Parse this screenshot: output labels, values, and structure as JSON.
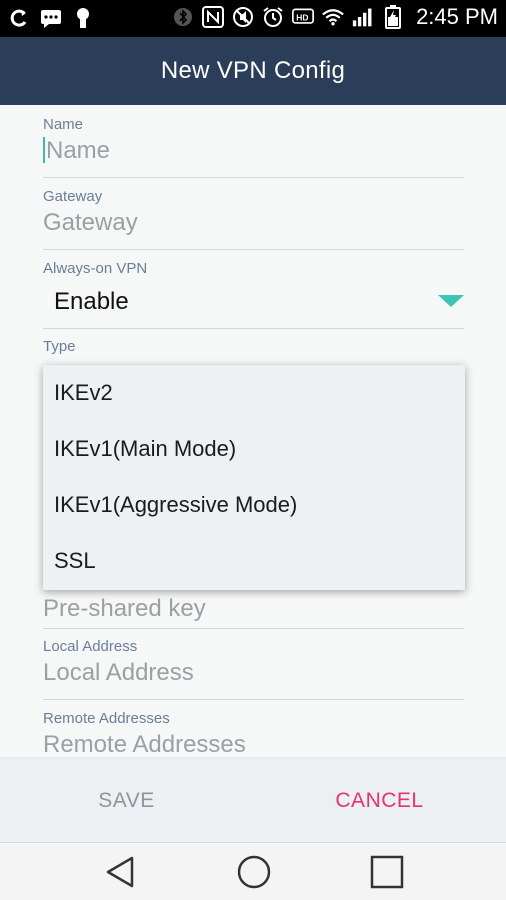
{
  "status_bar": {
    "time": "2:45 PM",
    "battery": "charging",
    "signal": "full",
    "wifi": "connected"
  },
  "app_bar": {
    "title": "New VPN Config"
  },
  "form": {
    "name": {
      "label": "Name",
      "placeholder": "Name"
    },
    "gateway": {
      "label": "Gateway",
      "placeholder": "Gateway"
    },
    "always_on": {
      "label": "Always-on VPN",
      "value": "Enable"
    },
    "type": {
      "label": "Type"
    },
    "psk": {
      "placeholder": "Pre-shared key"
    },
    "local_address": {
      "label": "Local Address",
      "placeholder": "Local Address"
    },
    "remote_addresses": {
      "label": "Remote Addresses",
      "placeholder": "Remote Addresses"
    }
  },
  "type_menu": {
    "options": [
      "IKEv2",
      "IKEv1(Main Mode)",
      "IKEv1(Aggressive Mode)",
      "SSL"
    ]
  },
  "actions": {
    "save": "SAVE",
    "cancel": "CANCEL"
  },
  "nav": {
    "icons": [
      "back-icon",
      "home-icon",
      "recents-icon"
    ]
  },
  "colors": {
    "app_bar": "#2b3e59",
    "accent": "#3fc3b7",
    "cancel": "#e5336b",
    "label": "#6b7e99"
  }
}
